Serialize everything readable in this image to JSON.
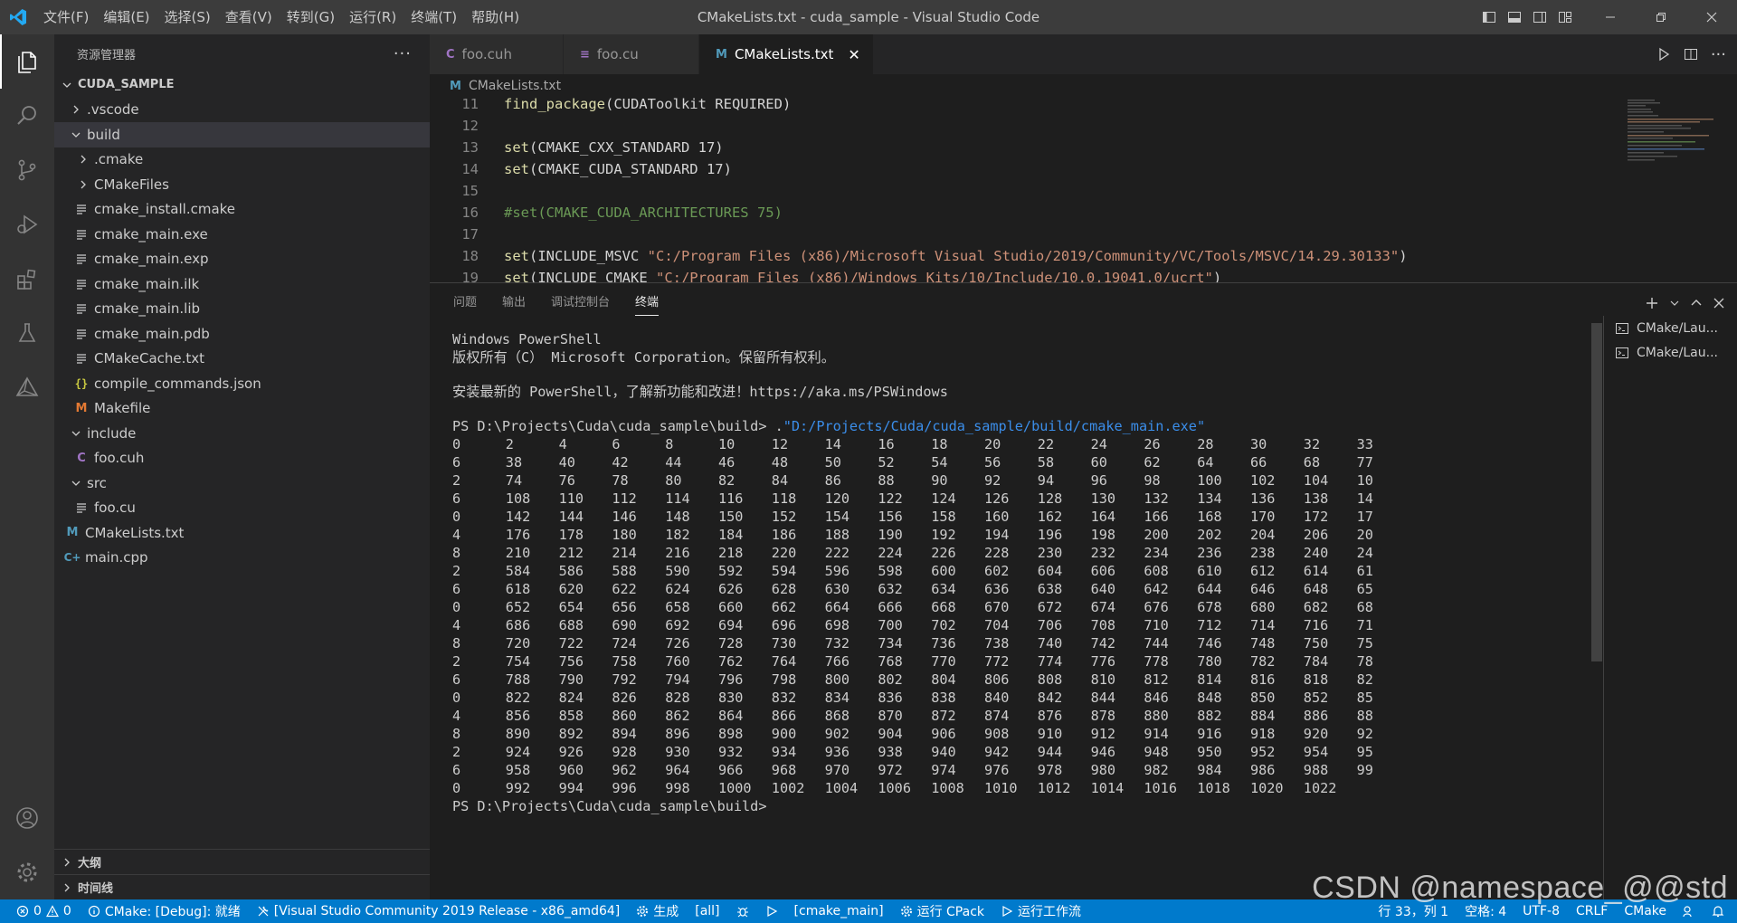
{
  "titlebar": {
    "menu": [
      "文件(F)",
      "编辑(E)",
      "选择(S)",
      "查看(V)",
      "转到(G)",
      "运行(R)",
      "终端(T)",
      "帮助(H)"
    ],
    "window_title": "CMakeLists.txt - cuda_sample - Visual Studio Code"
  },
  "sidebar": {
    "title": "资源管理器",
    "more": "···",
    "root": "CUDA_SAMPLE",
    "tree": [
      {
        "label": ".vscode",
        "type": "folder",
        "depth": 1,
        "open": false,
        "icon": ""
      },
      {
        "label": "build",
        "type": "folder",
        "depth": 1,
        "open": true,
        "icon": ""
      },
      {
        "label": ".cmake",
        "type": "folder",
        "depth": 2,
        "open": false,
        "icon": ""
      },
      {
        "label": "CMakeFiles",
        "type": "folder",
        "depth": 2,
        "open": false,
        "icon": ""
      },
      {
        "label": "cmake_install.cmake",
        "type": "file",
        "depth": 2,
        "icon": "lines"
      },
      {
        "label": "cmake_main.exe",
        "type": "file",
        "depth": 2,
        "icon": "lines"
      },
      {
        "label": "cmake_main.exp",
        "type": "file",
        "depth": 2,
        "icon": "lines"
      },
      {
        "label": "cmake_main.ilk",
        "type": "file",
        "depth": 2,
        "icon": "lines"
      },
      {
        "label": "cmake_main.lib",
        "type": "file",
        "depth": 2,
        "icon": "lines"
      },
      {
        "label": "cmake_main.pdb",
        "type": "file",
        "depth": 2,
        "icon": "lines"
      },
      {
        "label": "CMakeCache.txt",
        "type": "file",
        "depth": 2,
        "icon": "lines"
      },
      {
        "label": "compile_commands.json",
        "type": "file",
        "depth": 2,
        "icon": "json"
      },
      {
        "label": "Makefile",
        "type": "file",
        "depth": 2,
        "icon": "m-orange"
      },
      {
        "label": "include",
        "type": "folder",
        "depth": 1,
        "open": true,
        "icon": ""
      },
      {
        "label": "foo.cuh",
        "type": "file",
        "depth": 2,
        "icon": "c"
      },
      {
        "label": "src",
        "type": "folder",
        "depth": 1,
        "open": true,
        "icon": ""
      },
      {
        "label": "foo.cu",
        "type": "file",
        "depth": 2,
        "icon": "lines"
      },
      {
        "label": "CMakeLists.txt",
        "type": "file",
        "depth": 1,
        "icon": "m-blue"
      },
      {
        "label": "main.cpp",
        "type": "file",
        "depth": 1,
        "icon": "cpp"
      }
    ],
    "outline": "大纲",
    "timeline": "时间线"
  },
  "editor": {
    "tabs": [
      {
        "label": "foo.cuh",
        "icon": "C",
        "active": false
      },
      {
        "label": "foo.cu",
        "icon": "≡",
        "active": false
      },
      {
        "label": "CMakeLists.txt",
        "icon": "M",
        "active": true
      }
    ],
    "tab_close": "✕",
    "breadcrumb": "CMakeLists.txt",
    "breadcrumb_icon": "M",
    "lines": [
      {
        "n": "11",
        "fn": "find_package",
        "args": "(CUDAToolkit REQUIRED)",
        "str": "",
        "tail": "",
        "comment": ""
      },
      {
        "n": "12",
        "fn": "",
        "args": "",
        "str": "",
        "tail": "",
        "comment": ""
      },
      {
        "n": "13",
        "fn": "set",
        "args": "(CMAKE_CXX_STANDARD 17)",
        "str": "",
        "tail": "",
        "comment": ""
      },
      {
        "n": "14",
        "fn": "set",
        "args": "(CMAKE_CUDA_STANDARD 17)",
        "str": "",
        "tail": "",
        "comment": ""
      },
      {
        "n": "15",
        "fn": "",
        "args": "",
        "str": "",
        "tail": "",
        "comment": ""
      },
      {
        "n": "16",
        "fn": "",
        "args": "",
        "str": "",
        "tail": "",
        "comment": "#set(CMAKE_CUDA_ARCHITECTURES 75)"
      },
      {
        "n": "17",
        "fn": "",
        "args": "",
        "str": "",
        "tail": "",
        "comment": ""
      },
      {
        "n": "18",
        "fn": "set",
        "args": "(INCLUDE_MSVC ",
        "str": "\"C:/Program Files (x86)/Microsoft Visual Studio/2019/Community/VC/Tools/MSVC/14.29.30133\"",
        "tail": ")",
        "comment": ""
      },
      {
        "n": "19",
        "fn": "set",
        "args": "(INCLUDE_CMAKE ",
        "str": "\"C:/Program Files (x86)/Windows Kits/10/Include/10.0.19041.0/ucrt\"",
        "tail": ")",
        "comment": ""
      }
    ]
  },
  "panel": {
    "tabs": [
      "问题",
      "输出",
      "调试控制台",
      "终端"
    ],
    "active_tab": "终端",
    "terminal_header": [
      "Windows PowerShell",
      "版权所有（C） Microsoft Corporation。保留所有权利。",
      "",
      "安装最新的 PowerShell，了解新功能和改进！https://aka.ms/PSWindows",
      ""
    ],
    "prompt": "PS D:\\Projects\\Cuda\\cuda_sample\\build> ",
    "command_prefix": ".",
    "command": "\"D:/Projects/Cuda/cuda_sample/build/cmake_main.exe\"",
    "rows": [
      [
        "0",
        "2",
        "4",
        "6",
        "8",
        "10",
        "12",
        "14",
        "16",
        "18",
        "20",
        "22",
        "24",
        "26",
        "28",
        "30",
        "32",
        "33"
      ],
      [
        "6",
        "38",
        "40",
        "42",
        "44",
        "46",
        "48",
        "50",
        "52",
        "54",
        "56",
        "58",
        "60",
        "62",
        "64",
        "66",
        "68",
        "77"
      ],
      [
        "2",
        "74",
        "76",
        "78",
        "80",
        "82",
        "84",
        "86",
        "88",
        "90",
        "92",
        "94",
        "96",
        "98",
        "100",
        "102",
        "104",
        "10"
      ],
      [
        "6",
        "108",
        "110",
        "112",
        "114",
        "116",
        "118",
        "120",
        "122",
        "124",
        "126",
        "128",
        "130",
        "132",
        "134",
        "136",
        "138",
        "14"
      ],
      [
        "0",
        "142",
        "144",
        "146",
        "148",
        "150",
        "152",
        "154",
        "156",
        "158",
        "160",
        "162",
        "164",
        "166",
        "168",
        "170",
        "172",
        "17"
      ],
      [
        "4",
        "176",
        "178",
        "180",
        "182",
        "184",
        "186",
        "188",
        "190",
        "192",
        "194",
        "196",
        "198",
        "200",
        "202",
        "204",
        "206",
        "20"
      ],
      [
        "8",
        "210",
        "212",
        "214",
        "216",
        "218",
        "220",
        "222",
        "224",
        "226",
        "228",
        "230",
        "232",
        "234",
        "236",
        "238",
        "240",
        "24"
      ],
      [
        "2",
        "584",
        "586",
        "588",
        "590",
        "592",
        "594",
        "596",
        "598",
        "600",
        "602",
        "604",
        "606",
        "608",
        "610",
        "612",
        "614",
        "61"
      ],
      [
        "6",
        "618",
        "620",
        "622",
        "624",
        "626",
        "628",
        "630",
        "632",
        "634",
        "636",
        "638",
        "640",
        "642",
        "644",
        "646",
        "648",
        "65"
      ],
      [
        "0",
        "652",
        "654",
        "656",
        "658",
        "660",
        "662",
        "664",
        "666",
        "668",
        "670",
        "672",
        "674",
        "676",
        "678",
        "680",
        "682",
        "68"
      ],
      [
        "4",
        "686",
        "688",
        "690",
        "692",
        "694",
        "696",
        "698",
        "700",
        "702",
        "704",
        "706",
        "708",
        "710",
        "712",
        "714",
        "716",
        "71"
      ],
      [
        "8",
        "720",
        "722",
        "724",
        "726",
        "728",
        "730",
        "732",
        "734",
        "736",
        "738",
        "740",
        "742",
        "744",
        "746",
        "748",
        "750",
        "75"
      ],
      [
        "2",
        "754",
        "756",
        "758",
        "760",
        "762",
        "764",
        "766",
        "768",
        "770",
        "772",
        "774",
        "776",
        "778",
        "780",
        "782",
        "784",
        "78"
      ],
      [
        "6",
        "788",
        "790",
        "792",
        "794",
        "796",
        "798",
        "800",
        "802",
        "804",
        "806",
        "808",
        "810",
        "812",
        "814",
        "816",
        "818",
        "82"
      ],
      [
        "0",
        "822",
        "824",
        "826",
        "828",
        "830",
        "832",
        "834",
        "836",
        "838",
        "840",
        "842",
        "844",
        "846",
        "848",
        "850",
        "852",
        "85"
      ],
      [
        "4",
        "856",
        "858",
        "860",
        "862",
        "864",
        "866",
        "868",
        "870",
        "872",
        "874",
        "876",
        "878",
        "880",
        "882",
        "884",
        "886",
        "88"
      ],
      [
        "8",
        "890",
        "892",
        "894",
        "896",
        "898",
        "900",
        "902",
        "904",
        "906",
        "908",
        "910",
        "912",
        "914",
        "916",
        "918",
        "920",
        "92"
      ],
      [
        "2",
        "924",
        "926",
        "928",
        "930",
        "932",
        "934",
        "936",
        "938",
        "940",
        "942",
        "944",
        "946",
        "948",
        "950",
        "952",
        "954",
        "95"
      ],
      [
        "6",
        "958",
        "960",
        "962",
        "964",
        "966",
        "968",
        "970",
        "972",
        "974",
        "976",
        "978",
        "980",
        "982",
        "984",
        "986",
        "988",
        "99"
      ],
      [
        "0",
        "992",
        "994",
        "996",
        "998",
        "1000",
        "1002",
        "1004",
        "1006",
        "1008",
        "1010",
        "1012",
        "1014",
        "1016",
        "1018",
        "1020",
        "1022",
        ""
      ]
    ],
    "final_prompt": "PS D:\\Projects\\Cuda\\cuda_sample\\build>",
    "terminal_list": [
      "CMake/Lau...",
      "CMake/Lau..."
    ]
  },
  "statusbar": {
    "errors": "0",
    "warnings": "0",
    "cmake_status": "CMake: [Debug]: 就绪",
    "kit": "[Visual Studio Community 2019 Release - x86_amd64]",
    "build": "生成",
    "target_all": "[all]",
    "launch_target": "[cmake_main]",
    "cpack": "运行 CPack",
    "workflow": "运行工作流",
    "position": "行 33，列 1",
    "spaces": "空格: 4",
    "encoding": "UTF-8",
    "eol": "CRLF",
    "language": "CMake"
  },
  "watermark": "CSDN @namespace_@@std",
  "colors": {
    "accent": "#007acc",
    "titlebar": "#3c3c3c",
    "sidebar": "#252526",
    "editor": "#1e1e1e",
    "string": "#ce9178",
    "function": "#dcdcaa",
    "comment": "#6a9955",
    "term_string": "#3b8eea"
  }
}
